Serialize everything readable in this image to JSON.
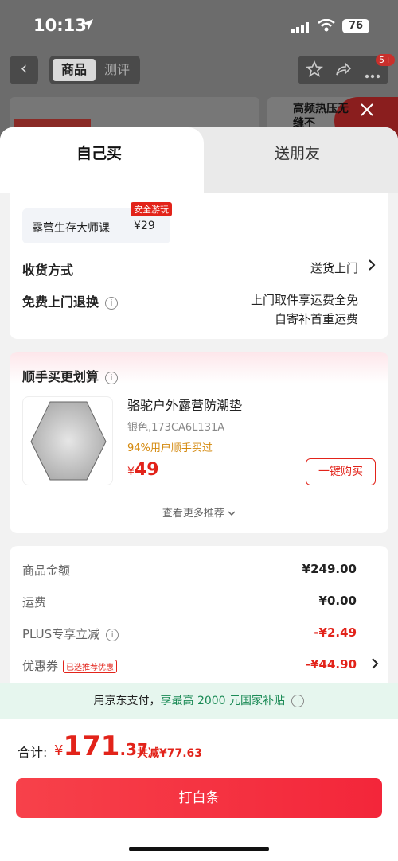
{
  "status_bar": {
    "time": "10:13",
    "battery": "76"
  },
  "nav": {
    "tabs": [
      "商品",
      "测评"
    ],
    "badge": "5+"
  },
  "banner": {
    "right_text": "高频热压无缝不"
  },
  "sheet": {
    "tabs": {
      "self": "自己买",
      "friend": "送朋友"
    },
    "course": {
      "name": "露营生存大师课",
      "price": "¥29",
      "tag": "安全游玩"
    },
    "delivery": {
      "label": "收货方式",
      "value": "送货上门"
    },
    "return": {
      "label": "免费上门退换",
      "line1": "上门取件享运费全免",
      "line2": "自寄补首重运费"
    },
    "addon": {
      "title": "顺手买更划算",
      "product_name": "骆驼户外露营防潮垫",
      "product_spec": "银色,173CA6L131A",
      "buyers": "94%用户顺手买过",
      "price_symbol": "¥",
      "price": "49",
      "buy_label": "一键购买",
      "more_label": "查看更多推荐"
    },
    "summary": {
      "goods_label": "商品金额",
      "goods_value": "¥249.00",
      "shipping_label": "运费",
      "shipping_value": "¥0.00",
      "plus_label": "PLUS专享立减",
      "plus_value": "-¥2.49",
      "coupon_label": "优惠券",
      "coupon_tag": "已选推荐优惠",
      "coupon_value": "-¥44.90"
    },
    "subsidy": {
      "prefix": "用京东支付，",
      "highlight": "享最高 2000 元国家补贴"
    },
    "footer": {
      "total_label": "合计:",
      "currency": "¥",
      "total_int": "171",
      "total_dec": ".37",
      "saved": "共减¥77.63",
      "pay_label": "打白条"
    }
  },
  "colors": {
    "accent": "#e2231a",
    "subsidy_green": "#1a8a55"
  },
  "icons": [
    "location-arrow-icon",
    "signal-icon",
    "wifi-icon",
    "back-arrow-icon",
    "star-icon",
    "share-icon",
    "close-icon",
    "info-icon",
    "chevron-right-icon",
    "chevron-down-icon"
  ]
}
